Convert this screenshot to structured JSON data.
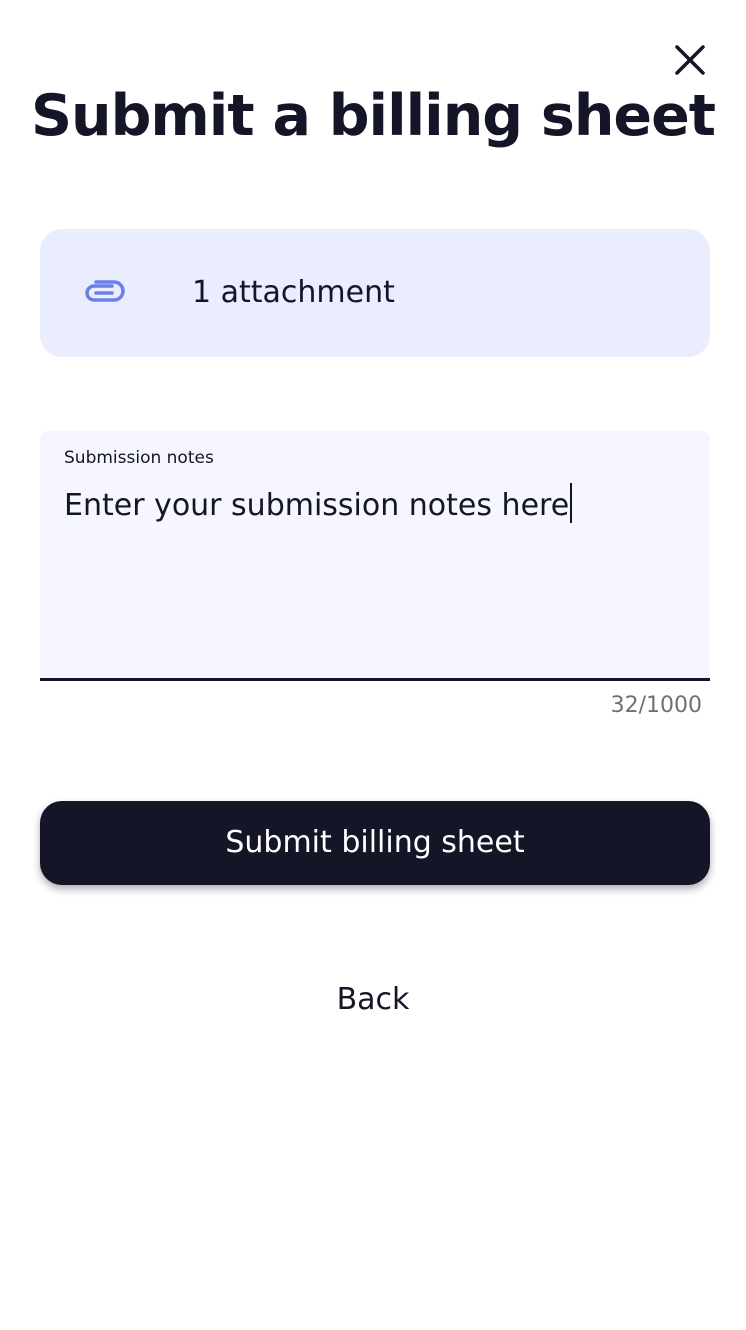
{
  "header": {
    "title": "Submit a billing sheet",
    "close_icon": "close-icon"
  },
  "attachment": {
    "icon": "paperclip-icon",
    "label": "1 attachment",
    "background": "#eaedfd",
    "icon_color": "#6b7fe8"
  },
  "notes": {
    "label": "Submission notes",
    "value": "Enter your submission notes here",
    "counter": "32/1000"
  },
  "actions": {
    "submit_label": "Submit billing sheet",
    "back_label": "Back"
  },
  "colors": {
    "primary": "#151528",
    "field_background": "#f5f6fe"
  }
}
